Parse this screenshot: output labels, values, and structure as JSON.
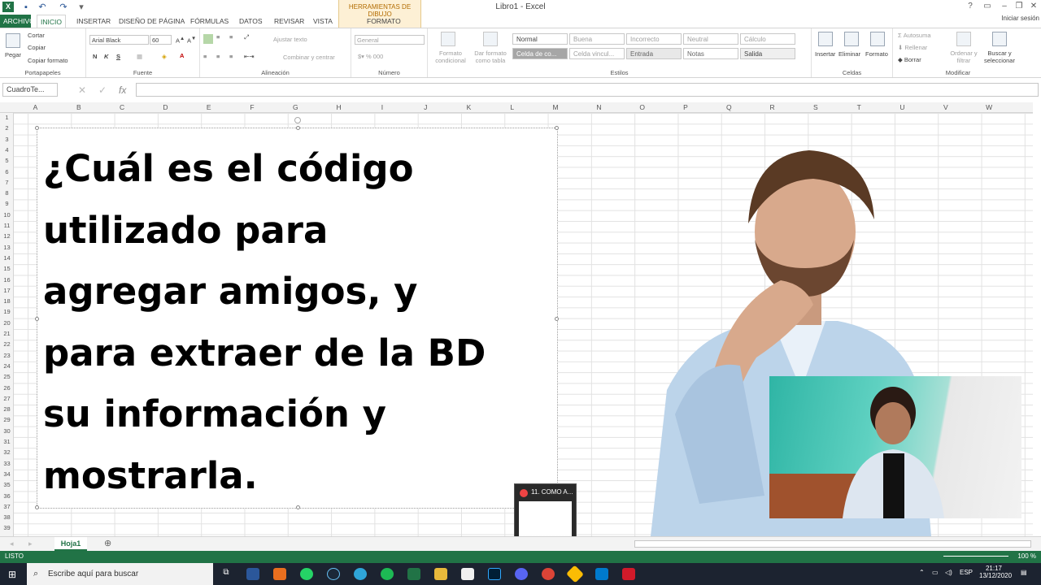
{
  "window": {
    "title": "Libro1 - Excel",
    "context_group": "HERRAMIENTAS DE DIBUJO",
    "context_tab": "FORMATO",
    "signin": "Iniciar sesión"
  },
  "tabs": [
    "ARCHIVO",
    "INICIO",
    "INSERTAR",
    "DISEÑO DE PÁGINA",
    "FÓRMULAS",
    "DATOS",
    "REVISAR",
    "VISTA"
  ],
  "ribbon": {
    "clipboard": {
      "name": "Portapapeles",
      "paste": "Pegar",
      "cut": "Cortar",
      "copy": "Copiar",
      "format_painter": "Copiar formato"
    },
    "font": {
      "name": "Fuente",
      "family": "Arial Black",
      "size": "60",
      "bold": "N",
      "italic": "K",
      "underline": "S"
    },
    "alignment": {
      "name": "Alineación",
      "wrap": "Ajustar texto",
      "merge": "Combinar y centrar"
    },
    "number": {
      "name": "Número",
      "format": "General"
    },
    "styles": {
      "name": "Estilos",
      "cond_format": "Formato condicional",
      "table_format": "Dar formato como tabla",
      "cells": [
        "Normal",
        "Buena",
        "Incorrecto",
        "Neutral",
        "Cálculo",
        "Celda de co...",
        "Celda vincul...",
        "Entrada",
        "Notas",
        "Salida"
      ]
    },
    "cells": {
      "name": "Celdas",
      "insert": "Insertar",
      "delete": "Eliminar",
      "format": "Formato"
    },
    "editing": {
      "name": "Modificar",
      "autosum": "Autosuma",
      "fill": "Rellenar",
      "clear": "Borrar",
      "sort": "Ordenar y filtrar",
      "find": "Buscar y seleccionar"
    }
  },
  "formula_bar": {
    "name_box": "CuadroTe...",
    "fx": "fx",
    "value": ""
  },
  "columns": [
    "A",
    "B",
    "C",
    "D",
    "E",
    "F",
    "G",
    "H",
    "I",
    "J",
    "K",
    "L",
    "M",
    "N",
    "O",
    "P",
    "Q",
    "R",
    "S",
    "T",
    "U",
    "V",
    "W"
  ],
  "rows": [
    "1",
    "2",
    "3",
    "4",
    "5",
    "6",
    "7",
    "8",
    "9",
    "10",
    "11",
    "12",
    "13",
    "14",
    "15",
    "16",
    "17",
    "18",
    "19",
    "20",
    "21",
    "22",
    "23",
    "24",
    "25",
    "26",
    "27",
    "28",
    "29",
    "30",
    "31",
    "32",
    "33",
    "34",
    "35",
    "36",
    "37",
    "38",
    "39"
  ],
  "textbox": {
    "lines": [
      "¿Cuál es el código",
      "utilizado para",
      "agregar amigos, y",
      "para extraer de la BD",
      "su información y",
      "mostrarla."
    ]
  },
  "taskbar_preview": {
    "title": "11. COMO A..."
  },
  "sheet": {
    "tab": "Hoja1"
  },
  "status": {
    "ready": "LISTO",
    "zoom": "100 %"
  },
  "taskbar": {
    "search": "Escribe aquí para buscar",
    "lang": "ESP",
    "time": "21:17",
    "date": "13/12/2020"
  },
  "colors": {
    "excel_green": "#217346",
    "taskbar": "#1c2330"
  }
}
